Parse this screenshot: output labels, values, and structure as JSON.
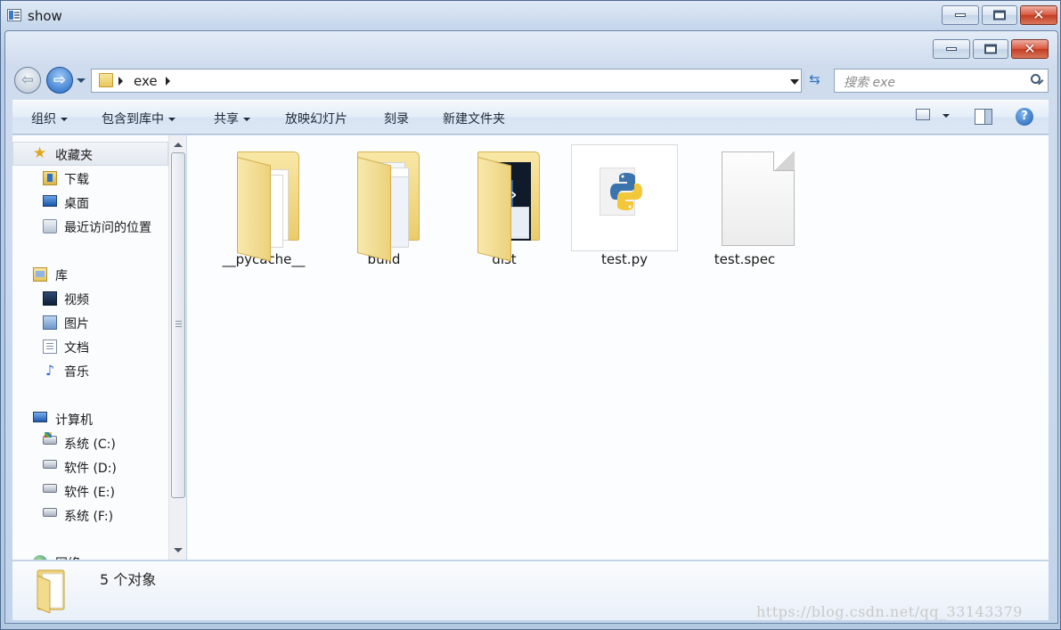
{
  "outer_window": {
    "title": "show",
    "app_icon": "window-app-icon"
  },
  "caption_buttons": {
    "minimize": "minimize-icon",
    "maximize": "maximize-icon",
    "close": "close-icon"
  },
  "address_bar": {
    "back_icon": "back-arrow-icon",
    "forward_icon": "forward-arrow-icon",
    "path": [
      "exe"
    ],
    "refresh_icon": "refresh-icon"
  },
  "search": {
    "placeholder": "搜索 exe",
    "icon": "search-icon"
  },
  "toolbar": {
    "organize": "组织",
    "include_in_library": "包含到库中",
    "share": "共享",
    "slideshow": "放映幻灯片",
    "burn": "刻录",
    "new_folder": "新建文件夹",
    "view_icon": "change-view-icon",
    "preview_pane_icon": "preview-pane-icon",
    "help_icon": "help-icon"
  },
  "nav": {
    "favorites": {
      "label": "收藏夹",
      "items": [
        "下载",
        "桌面",
        "最近访问的位置"
      ]
    },
    "libraries": {
      "label": "库",
      "items": [
        "视频",
        "图片",
        "文档",
        "音乐"
      ]
    },
    "computer": {
      "label": "计算机",
      "drives": [
        "系统 (C:)",
        "软件 (D:)",
        "软件 (E:)",
        "系统 (F:)"
      ]
    },
    "network": {
      "label": "网络"
    }
  },
  "files": [
    {
      "name": "__pycache__",
      "type": "folder"
    },
    {
      "name": "build",
      "type": "folder"
    },
    {
      "name": "dist",
      "type": "folder"
    },
    {
      "name": "test.py",
      "type": "python-file"
    },
    {
      "name": "test.spec",
      "type": "file"
    }
  ],
  "details": {
    "count_text": "5 个对象"
  },
  "watermark": "https://blog.csdn.net/qq_33143379",
  "colors": {
    "accent": "#2166c2",
    "selection": "#e4e9f0",
    "folder": "#ebcc6a"
  }
}
